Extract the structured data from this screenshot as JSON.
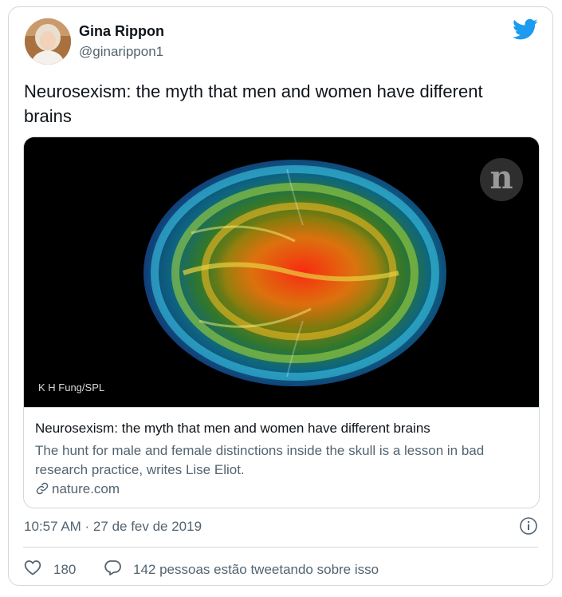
{
  "author": {
    "name": "Gina Rippon",
    "handle": "@ginarippon1"
  },
  "tweet": {
    "text": "Neurosexism: the myth that men and women have different brains"
  },
  "card": {
    "image_credit": "K H Fung/SPL",
    "logo_letter": "n",
    "title": "Neurosexism: the myth that men and women have different brains",
    "description": "The hunt for male and female distinctions inside the skull is a lesson in bad research practice, writes Lise Eliot.",
    "domain": "nature.com"
  },
  "meta": {
    "timestamp": "10:57 AM · 27 de fev de 2019"
  },
  "actions": {
    "likes": "180",
    "retweeting": "142 pessoas estão tweetando sobre isso"
  },
  "colors": {
    "twitter_blue": "#1d9bf0",
    "secondary_text": "#536471",
    "border": "#cfd9de"
  },
  "icons": [
    "twitter-bird-icon",
    "link-icon",
    "info-icon",
    "heart-icon",
    "reply-bubble-icon"
  ]
}
